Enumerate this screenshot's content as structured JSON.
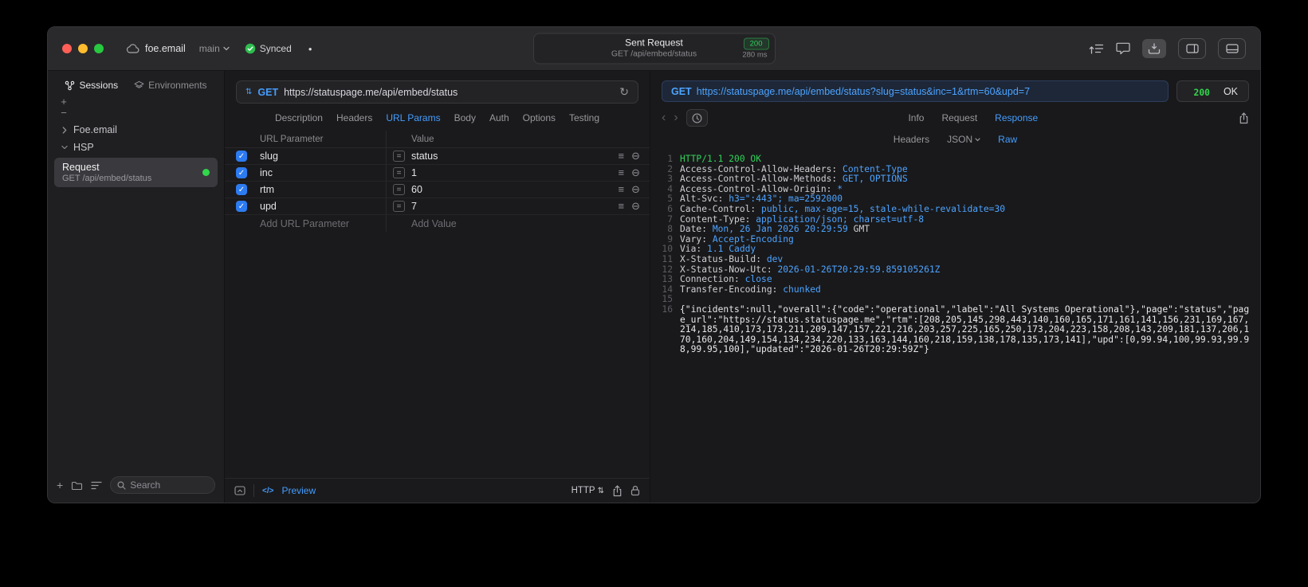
{
  "colors": {
    "accent_blue": "#459DFF",
    "success_green": "#32D74B",
    "checkbox_blue": "#2D7BF0"
  },
  "icons": {
    "plus": "+",
    "minus": "−",
    "check": "✓",
    "dirty_dot": "●",
    "chevron_back": "‹",
    "chevron_forward": "›",
    "method_arrows": "⇅",
    "refresh": "↻",
    "equals": "=",
    "drag_handle": "≡",
    "remove_circle": "⊖",
    "code_preview": "</>"
  },
  "titlebar": {
    "project": "foe.email",
    "branch": "main",
    "sync_label": "Synced",
    "request_summary": {
      "title": "Sent Request",
      "status_code": "200",
      "method_path": "GET /api/embed/status",
      "duration": "280 ms"
    }
  },
  "sidebar": {
    "tabs": [
      {
        "label": "Sessions",
        "active": true
      },
      {
        "label": "Environments",
        "active": false
      }
    ],
    "tree": [
      {
        "label": "Foe.email",
        "expanded": false
      },
      {
        "label": "HSP",
        "expanded": true
      }
    ],
    "request_item": {
      "title": "Request",
      "subtitle": "GET /api/embed/status"
    },
    "search_placeholder": "Search"
  },
  "request_editor": {
    "method": "GET",
    "url": "https://statuspage.me/api/embed/status",
    "tabs": [
      "Description",
      "Headers",
      "URL Params",
      "Body",
      "Auth",
      "Options",
      "Testing"
    ],
    "active_tab": "URL Params",
    "params": {
      "col_name": "URL Parameter",
      "col_value": "Value",
      "rows": [
        {
          "name": "slug",
          "value": "status",
          "checked": true
        },
        {
          "name": "inc",
          "value": "1",
          "checked": true
        },
        {
          "name": "rtm",
          "value": "60",
          "checked": true
        },
        {
          "name": "upd",
          "value": "7",
          "checked": true
        }
      ],
      "add_name": "Add URL Parameter",
      "add_value": "Add Value"
    },
    "footer": {
      "preview": "Preview",
      "protocol": "HTTP"
    }
  },
  "response": {
    "request_line": {
      "method": "GET",
      "url": "https://statuspage.me/api/embed/status?slug=status&inc=1&rtm=60&upd=7"
    },
    "status": {
      "code": "200",
      "text": "OK"
    },
    "tabs": [
      "Info",
      "Request",
      "Response"
    ],
    "active_tab": "Response",
    "subtabs": [
      {
        "label": "Headers",
        "dropdown": false
      },
      {
        "label": "JSON",
        "dropdown": true
      },
      {
        "label": "Raw",
        "dropdown": false
      }
    ],
    "active_subtab": "Raw",
    "code_lines": [
      {
        "n": "1",
        "segs": [
          {
            "t": "HTTP/1.1 200 OK",
            "c": "green"
          }
        ]
      },
      {
        "n": "2",
        "segs": [
          {
            "t": "Access-Control-Allow-Headers: ",
            "c": "key"
          },
          {
            "t": "Content-Type",
            "c": "val"
          }
        ]
      },
      {
        "n": "3",
        "segs": [
          {
            "t": "Access-Control-Allow-Methods: ",
            "c": "key"
          },
          {
            "t": "GET, OPTIONS",
            "c": "val"
          }
        ]
      },
      {
        "n": "4",
        "segs": [
          {
            "t": "Access-Control-Allow-Origin: ",
            "c": "key"
          },
          {
            "t": "*",
            "c": "val"
          }
        ]
      },
      {
        "n": "5",
        "segs": [
          {
            "t": "Alt-Svc: ",
            "c": "key"
          },
          {
            "t": "h3=\":443\"; ma=2592000",
            "c": "val"
          }
        ]
      },
      {
        "n": "6",
        "segs": [
          {
            "t": "Cache-Control: ",
            "c": "key"
          },
          {
            "t": "public, max-age=15, stale-while-revalidate=30",
            "c": "val"
          }
        ]
      },
      {
        "n": "7",
        "segs": [
          {
            "t": "Content-Type: ",
            "c": "key"
          },
          {
            "t": "application/json; charset=utf-8",
            "c": "val"
          }
        ]
      },
      {
        "n": "8",
        "segs": [
          {
            "t": "Date: ",
            "c": "key"
          },
          {
            "t": "Mon, 26 Jan 2026 20:29:59 ",
            "c": "val"
          },
          {
            "t": "GMT",
            "c": "key"
          }
        ]
      },
      {
        "n": "9",
        "segs": [
          {
            "t": "Vary: ",
            "c": "key"
          },
          {
            "t": "Accept-Encoding",
            "c": "val"
          }
        ]
      },
      {
        "n": "10",
        "segs": [
          {
            "t": "Via: ",
            "c": "key"
          },
          {
            "t": "1.1 Caddy",
            "c": "val"
          }
        ]
      },
      {
        "n": "11",
        "segs": [
          {
            "t": "X-Status-Build: ",
            "c": "key"
          },
          {
            "t": "dev",
            "c": "val"
          }
        ]
      },
      {
        "n": "12",
        "segs": [
          {
            "t": "X-Status-Now-Utc: ",
            "c": "key"
          },
          {
            "t": "2026-01-26T20:29:59.859105261Z",
            "c": "val"
          }
        ]
      },
      {
        "n": "13",
        "segs": [
          {
            "t": "Connection: ",
            "c": "key"
          },
          {
            "t": "close",
            "c": "val"
          }
        ]
      },
      {
        "n": "14",
        "segs": [
          {
            "t": "Transfer-Encoding: ",
            "c": "key"
          },
          {
            "t": "chunked",
            "c": "val"
          }
        ]
      },
      {
        "n": "15",
        "segs": []
      },
      {
        "n": "16",
        "segs": [
          {
            "t": "{\"incidents\":null,\"overall\":{\"code\":\"operational\",\"label\":\"All Systems Operational\"},\"page\":\"status\",\"page_url\":\"https://status.statuspage.me\",\"rtm\":[208,205,145,298,443,140,160,165,171,161,141,156,231,169,167,214,185,410,173,173,211,209,147,157,221,216,203,257,225,165,250,173,204,223,158,208,143,209,181,137,206,170,160,204,149,154,134,234,220,133,163,144,160,218,159,138,178,135,173,141],\"upd\":[0,99.94,100,99.93,99.98,99.95,100],\"updated\":\"2026-01-26T20:29:59Z\"}",
            "c": "body"
          }
        ]
      }
    ]
  }
}
